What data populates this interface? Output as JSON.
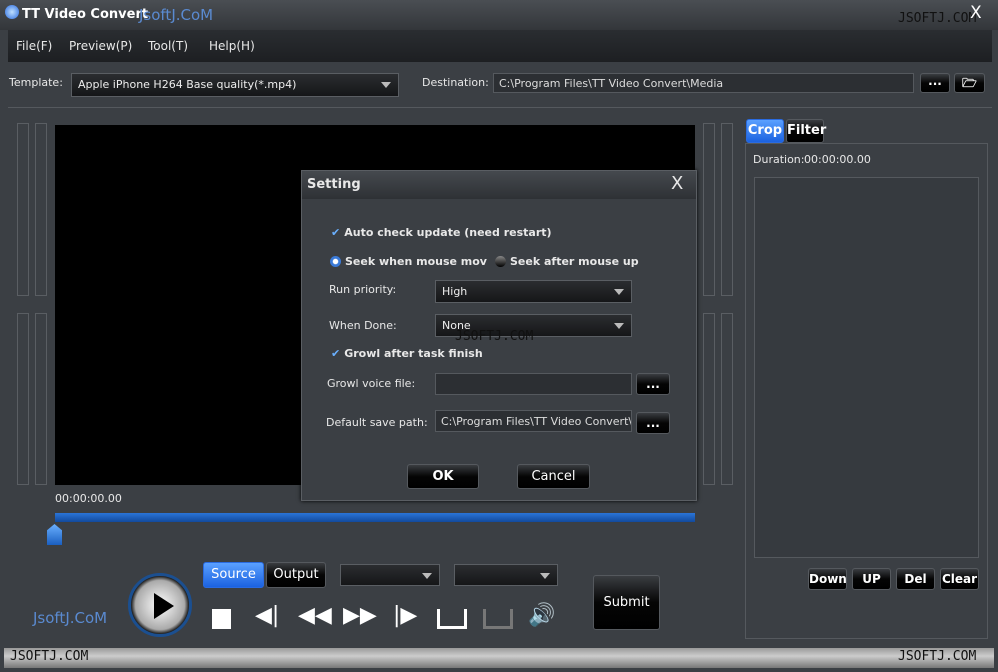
{
  "window": {
    "title": "TT Video Convert",
    "brand": "JsoftJ.CoM",
    "watermark": "JSOFTJ.COM",
    "close": "X"
  },
  "menu": [
    {
      "label": "File(F)"
    },
    {
      "label": "Preview(P)"
    },
    {
      "label": "Tool(T)"
    },
    {
      "label": "Help(H)"
    }
  ],
  "template": {
    "label": "Template:",
    "value": "Apple iPhone H264 Base quality(*.mp4)"
  },
  "destination": {
    "label": "Destination:",
    "value": "C:\\Program Files\\TT Video Convert\\Media",
    "browse": "...",
    "folder_icon": "folder-open-icon"
  },
  "player": {
    "time": "00:00:00.00",
    "progress": 0,
    "source": "Source",
    "output": "Output",
    "brand": "JsoftJ.CoM",
    "submit": "Submit",
    "active_view": "Source"
  },
  "right_panel": {
    "tabs": [
      {
        "label": "Crop",
        "active": true
      },
      {
        "label": "Filter",
        "active": false
      }
    ],
    "duration_label": "Duration:",
    "duration": "00:00:00.00",
    "buttons": [
      "Down",
      "UP",
      "Del",
      "Clear"
    ]
  },
  "dialog": {
    "title": "Setting",
    "close": "X",
    "auto_update": {
      "label": "Auto check update (need restart)",
      "checked": true
    },
    "seek_mov": {
      "label": "Seek when mouse mov",
      "selected": true
    },
    "seek_up": {
      "label": "Seek after mouse up",
      "selected": false
    },
    "priority": {
      "label": "Run priority:",
      "value": "High"
    },
    "when_done": {
      "label": "When Done:",
      "value": "None"
    },
    "growl": {
      "label": "Growl after task finish",
      "checked": true
    },
    "growl_file": {
      "label": "Growl voice file:",
      "value": "",
      "browse": "..."
    },
    "save_path": {
      "label": "Default save path:",
      "value": "C:\\Program Files\\TT Video Convert\\Mec",
      "browse": "..."
    },
    "ok": "OK",
    "cancel": "Cancel"
  },
  "colors": {
    "accent": "#2a6be0",
    "progress": "#1a5fc0",
    "background": "#3b3f44"
  }
}
